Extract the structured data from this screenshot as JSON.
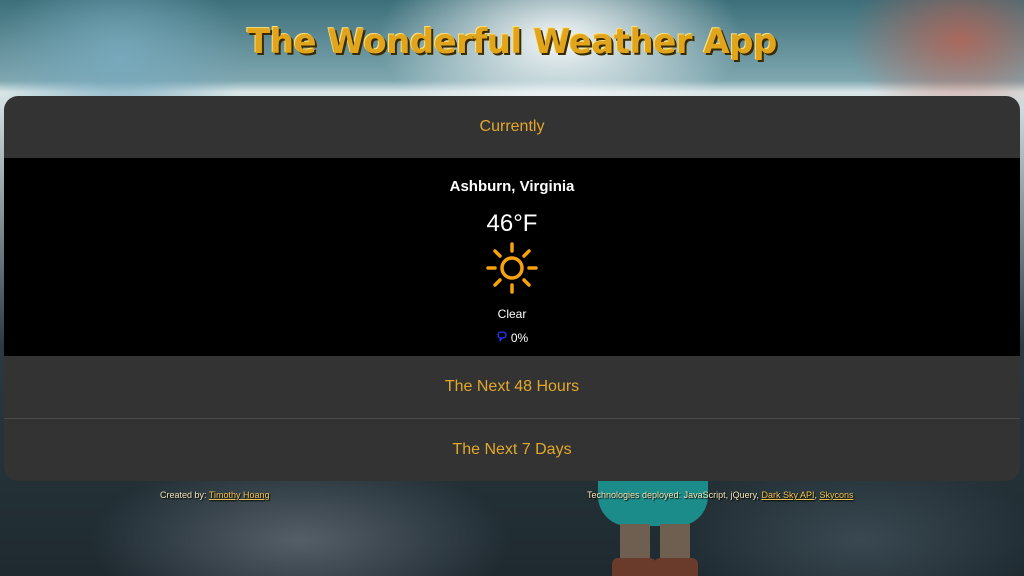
{
  "app": {
    "title": "The Wonderful Weather App"
  },
  "sections": {
    "currently_label": "Currently",
    "next48_label": "The Next 48 Hours",
    "next7_label": "The Next 7 Days"
  },
  "current": {
    "location": "Ashburn, Virginia",
    "temperature": "46°F",
    "icon": "clear-day-sun-icon",
    "summary": "Clear",
    "precip_icon": "raindrop-icon",
    "precip_probability": "0%"
  },
  "footer": {
    "created_by_label": "Created by:",
    "author_name": "Timothy Hoang",
    "tech_label": "Technologies deployed: JavaScript, jQuery,",
    "tech_link_1": "Dark Sky API",
    "tech_separator": ",",
    "tech_link_2": "Skycons"
  },
  "colors": {
    "accent": "#e3a82b",
    "title": "#e0a51c",
    "panel": "#333333",
    "current_bg": "#000000",
    "sun": "#f6a20b",
    "drop": "#1f3cff"
  }
}
